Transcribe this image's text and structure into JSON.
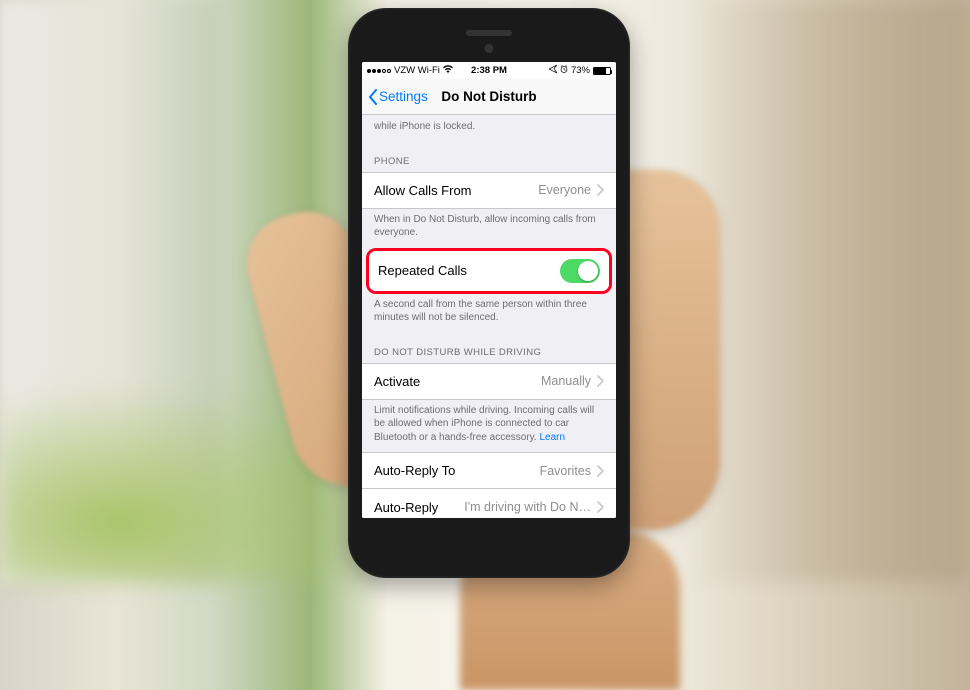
{
  "statusBar": {
    "carrier": "VZW Wi-Fi",
    "time": "2:38 PM",
    "batteryPercent": "73%"
  },
  "nav": {
    "back": "Settings",
    "title": "Do Not Disturb"
  },
  "topTrailingNote": "while iPhone is locked.",
  "phoneSection": {
    "header": "Phone",
    "allowCallsLabel": "Allow Calls From",
    "allowCallsValue": "Everyone",
    "allowCallsNote": "When in Do Not Disturb, allow incoming calls from everyone.",
    "repeatedCallsLabel": "Repeated Calls",
    "repeatedCallsNote": "A second call from the same person within three minutes will not be silenced."
  },
  "drivingSection": {
    "header": "Do Not Disturb While Driving",
    "activateLabel": "Activate",
    "activateValue": "Manually",
    "activateNoteStart": "Limit notifications while driving. Incoming calls will be allowed when iPhone is connected to car Bluetooth or a hands-free accessory. ",
    "activateNoteLink": "Learn",
    "autoReplyToLabel": "Auto-Reply To",
    "autoReplyToValue": "Favorites",
    "autoReplyLabel": "Auto-Reply",
    "autoReplyValue": "I'm driving with Do N…"
  }
}
